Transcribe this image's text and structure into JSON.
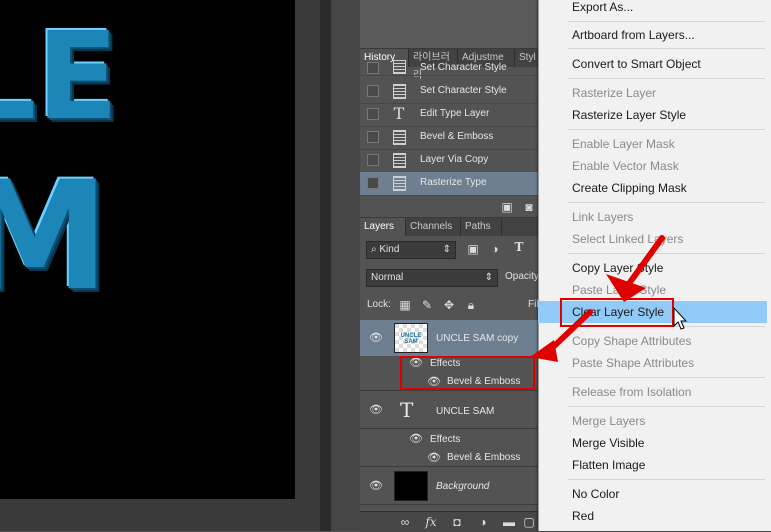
{
  "canvas": {
    "letters_row1": "LE",
    "letters_row2": "M"
  },
  "history": {
    "tabs": [
      "History",
      "라이브러리",
      "Adjustme",
      "Styl"
    ],
    "items": [
      {
        "label": "Set Character Style",
        "icon": "document-icon"
      },
      {
        "label": "Set Character Style",
        "icon": "document-icon"
      },
      {
        "label": "Edit Type Layer",
        "icon": "type-tool-icon"
      },
      {
        "label": "Bevel & Emboss",
        "icon": "document-icon"
      },
      {
        "label": "Layer Via Copy",
        "icon": "document-icon"
      },
      {
        "label": "Rasterize Type",
        "icon": "document-icon"
      }
    ],
    "type_glyph": "T"
  },
  "layers": {
    "tabs": [
      "Layers",
      "Channels",
      "Paths"
    ],
    "kind_label": "Kind",
    "blend_mode": "Normal",
    "opacity_label": "Opacity",
    "lock_label": "Lock:",
    "fill_label": "Fil",
    "thumb_text": "UNCLE SAM",
    "type_glyph": "T",
    "items": [
      {
        "name": "UNCLE SAM copy",
        "effects_label": "Effects",
        "effect": "Bevel & Emboss"
      },
      {
        "name": "UNCLE SAM",
        "effects_label": "Effects",
        "effect": "Bevel & Emboss"
      },
      {
        "name": "Background"
      }
    ]
  },
  "menu": {
    "items": [
      {
        "label": "Export As...",
        "enabled": true
      },
      {
        "label": "Artboard from Layers...",
        "enabled": true
      },
      {
        "label": "Convert to Smart Object",
        "enabled": true
      },
      {
        "label": "Rasterize Layer",
        "enabled": false
      },
      {
        "label": "Rasterize Layer Style",
        "enabled": true
      },
      {
        "label": "Enable Layer Mask",
        "enabled": false
      },
      {
        "label": "Enable Vector Mask",
        "enabled": false
      },
      {
        "label": "Create Clipping Mask",
        "enabled": true
      },
      {
        "label": "Link Layers",
        "enabled": false
      },
      {
        "label": "Select Linked Layers",
        "enabled": false
      },
      {
        "label": "Copy Layer Style",
        "enabled": true
      },
      {
        "label": "Paste Layer Style",
        "enabled": false
      },
      {
        "label": "Clear Layer Style",
        "enabled": true,
        "highlighted": true
      },
      {
        "label": "Copy Shape Attributes",
        "enabled": false
      },
      {
        "label": "Paste Shape Attributes",
        "enabled": false
      },
      {
        "label": "Release from Isolation",
        "enabled": false
      },
      {
        "label": "Merge Layers",
        "enabled": false
      },
      {
        "label": "Merge Visible",
        "enabled": true
      },
      {
        "label": "Flatten Image",
        "enabled": true
      },
      {
        "label": "No Color",
        "enabled": true
      },
      {
        "label": "Red",
        "enabled": true
      }
    ]
  },
  "colors": {
    "highlight": "#91c9f7",
    "annotation": "#e00000",
    "history_selected": "#6e7f92",
    "layer_selected": "#6e7f92"
  }
}
